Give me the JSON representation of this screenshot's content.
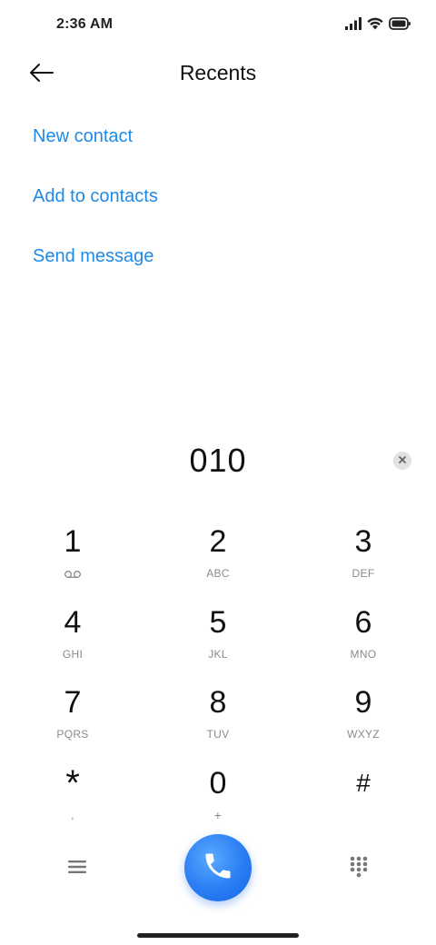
{
  "status_bar": {
    "time": "2:36 AM",
    "icons": [
      "signal-icon",
      "wifi-icon",
      "battery-icon"
    ]
  },
  "header": {
    "title": "Recents",
    "back_icon": "back-arrow-icon"
  },
  "actions": [
    {
      "label": "New contact"
    },
    {
      "label": "Add to contacts"
    },
    {
      "label": "Send message"
    }
  ],
  "dialer": {
    "number": "010",
    "clear_icon": "clear-icon"
  },
  "keypad": [
    {
      "digit": "1",
      "letters": "",
      "icon": "voicemail-icon"
    },
    {
      "digit": "2",
      "letters": "ABC"
    },
    {
      "digit": "3",
      "letters": "DEF"
    },
    {
      "digit": "4",
      "letters": "GHI"
    },
    {
      "digit": "5",
      "letters": "JKL"
    },
    {
      "digit": "6",
      "letters": "MNO"
    },
    {
      "digit": "7",
      "letters": "PQRS"
    },
    {
      "digit": "8",
      "letters": "TUV"
    },
    {
      "digit": "9",
      "letters": "WXYZ"
    },
    {
      "digit": "*",
      "letters": ","
    },
    {
      "digit": "0",
      "letters": "+"
    },
    {
      "digit": "#",
      "letters": ""
    }
  ],
  "bottom_bar": {
    "menu_icon": "menu-icon",
    "call_icon": "phone-icon",
    "dialpad_icon": "dialpad-icon"
  },
  "colors": {
    "link": "#1f8ae6",
    "call_button": "#2a7df3",
    "secondary_text": "#8a8a8a"
  }
}
